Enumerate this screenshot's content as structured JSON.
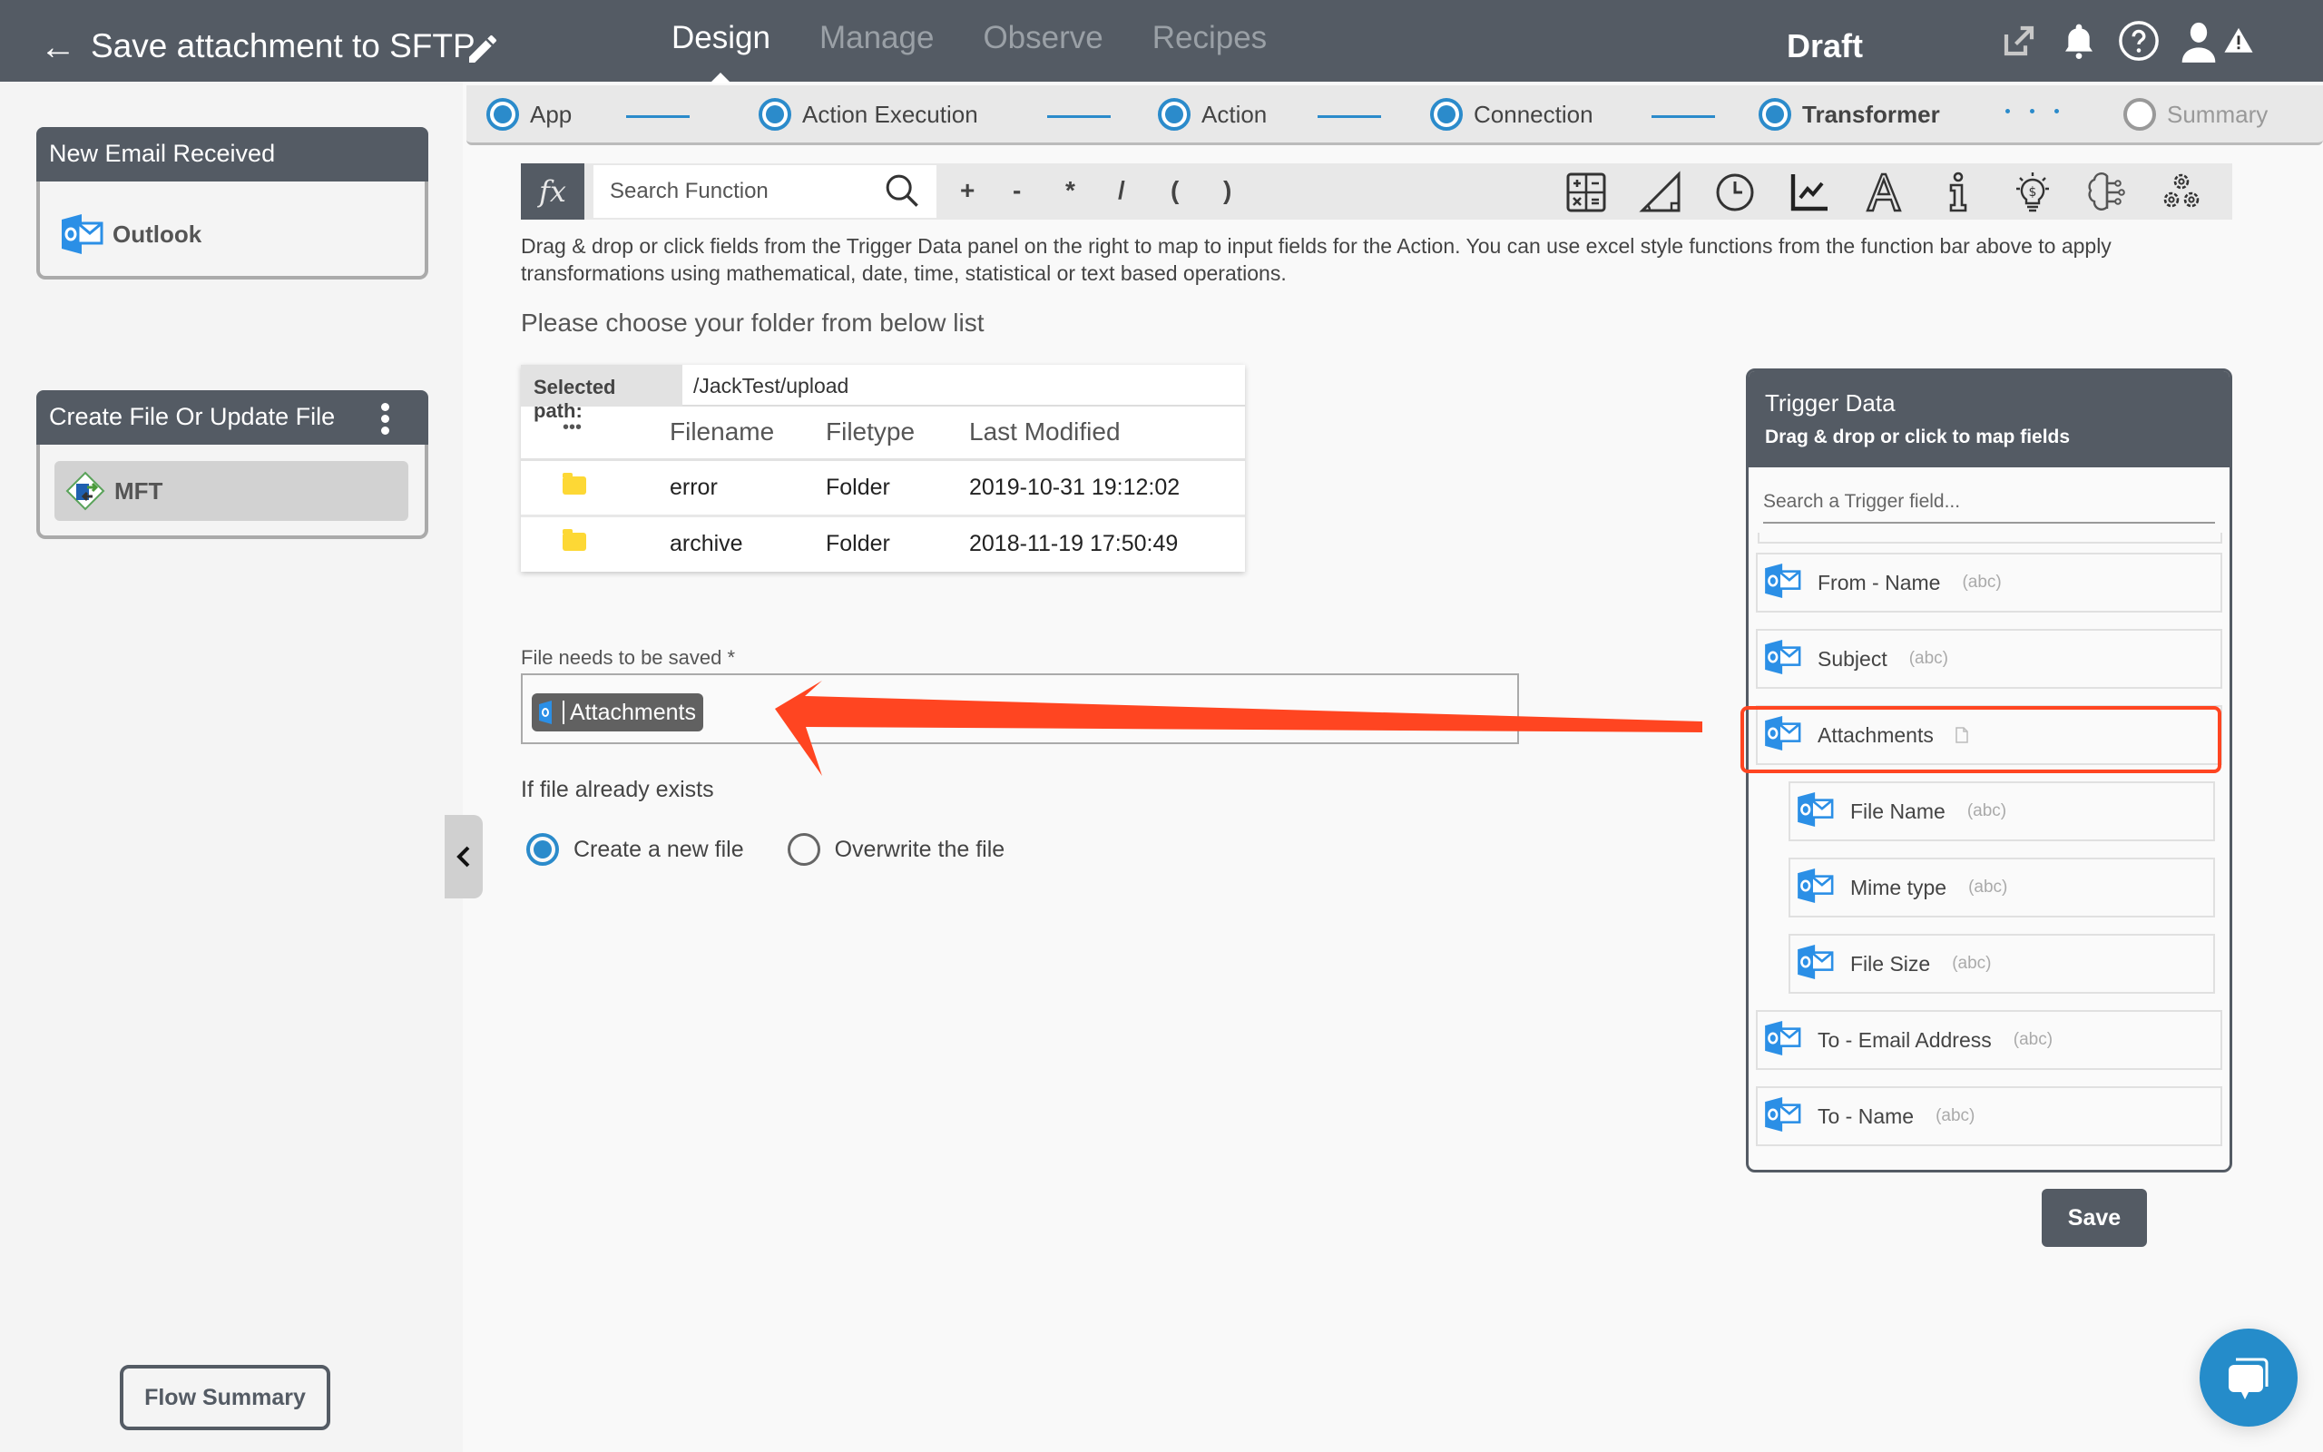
{
  "header": {
    "title": "Save attachment to SFTP",
    "status": "Draft",
    "tabs": [
      {
        "label": "Design",
        "active": true
      },
      {
        "label": "Manage",
        "active": false
      },
      {
        "label": "Observe",
        "active": false
      },
      {
        "label": "Recipes",
        "active": false
      }
    ],
    "icons": [
      "external-link-icon",
      "bell-icon",
      "help-icon",
      "user-icon",
      "warning-icon"
    ]
  },
  "sidebar": {
    "trigger_card": {
      "title": "New Email Received",
      "app": "Outlook"
    },
    "action_card": {
      "title": "Create File Or Update File",
      "app": "MFT"
    },
    "flow_summary_label": "Flow Summary"
  },
  "stepper": {
    "steps": [
      {
        "label": "App",
        "state": "done"
      },
      {
        "label": "Action Execution",
        "state": "done"
      },
      {
        "label": "Action",
        "state": "done"
      },
      {
        "label": "Connection",
        "state": "done"
      },
      {
        "label": "Transformer",
        "state": "current"
      },
      {
        "label": "Summary",
        "state": "todo"
      }
    ]
  },
  "function_bar": {
    "fx_label": "fx",
    "search_placeholder": "Search Function",
    "operators": [
      "+",
      "-",
      "*",
      "/",
      "(",
      ")"
    ],
    "tool_icons": [
      "math-calculator-icon",
      "trigonometry-icon",
      "clock-icon",
      "statistics-chart-icon",
      "text-icon",
      "info-icon",
      "finance-bulb-icon",
      "ai-brain-icon",
      "gears-icon"
    ]
  },
  "main": {
    "help_text": "Drag & drop or click fields from the Trigger Data panel on the right to map to input fields for the Action. You can use excel style functions from the function bar above to apply transformations using mathematical, date, time, statistical or text based operations.",
    "choose_folder_label": "Please choose your folder from below list",
    "folder_browser": {
      "selected_path_label": "Selected path:",
      "selected_path": "/JackTest/upload",
      "more_label": "•••",
      "columns": [
        "Filename",
        "Filetype",
        "Last Modified"
      ],
      "rows": [
        {
          "name": "error",
          "type": "Folder",
          "modified": "2019-10-31 19:12:02"
        },
        {
          "name": "archive",
          "type": "Folder",
          "modified": "2018-11-19 17:50:49"
        }
      ]
    },
    "file_field": {
      "label": "File needs to be saved *",
      "mapped_pill": "Attachments"
    },
    "exists_label": "If file already exists",
    "exists_options": [
      {
        "label": "Create a new file",
        "selected": true
      },
      {
        "label": "Overwrite the file",
        "selected": false
      }
    ]
  },
  "trigger_panel": {
    "title": "Trigger Data",
    "subtitle": "Drag & drop or click to map fields",
    "search_placeholder": "Search a Trigger field...",
    "fields": [
      {
        "name": "From - Name",
        "type": "(abc)",
        "level": 0
      },
      {
        "name": "Subject",
        "type": "(abc)",
        "level": 0
      },
      {
        "name": "Attachments",
        "type": "file",
        "level": 0,
        "highlighted": true
      },
      {
        "name": "File Name",
        "type": "(abc)",
        "level": 1
      },
      {
        "name": "Mime type",
        "type": "(abc)",
        "level": 1
      },
      {
        "name": "File Size",
        "type": "(abc)",
        "level": 1
      },
      {
        "name": "To - Email Address",
        "type": "(abc)",
        "level": 0
      },
      {
        "name": "To - Name",
        "type": "(abc)",
        "level": 0
      }
    ]
  },
  "save_label": "Save",
  "colors": {
    "header_bg": "#545b64",
    "accent_blue": "#2b8bcb",
    "annotation_red": "#ff4521",
    "folder_yellow": "#fdd835",
    "outlook_blue": "#2b8fe6"
  }
}
